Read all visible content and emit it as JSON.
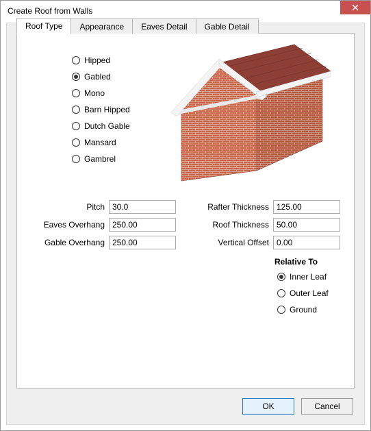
{
  "window": {
    "title": "Create Roof from Walls"
  },
  "tabs": [
    {
      "label": "Roof Type",
      "active": true
    },
    {
      "label": "Appearance",
      "active": false
    },
    {
      "label": "Eaves Detail",
      "active": false
    },
    {
      "label": "Gable Detail",
      "active": false
    }
  ],
  "roof_types": [
    {
      "label": "Hipped",
      "checked": false
    },
    {
      "label": "Gabled",
      "checked": true
    },
    {
      "label": "Mono",
      "checked": false
    },
    {
      "label": "Barn Hipped",
      "checked": false
    },
    {
      "label": "Dutch Gable",
      "checked": false
    },
    {
      "label": "Mansard",
      "checked": false
    },
    {
      "label": "Gambrel",
      "checked": false
    }
  ],
  "fields": {
    "left": [
      {
        "label": "Pitch",
        "value": "30.0"
      },
      {
        "label": "Eaves Overhang",
        "value": "250.00"
      },
      {
        "label": "Gable Overhang",
        "value": "250.00"
      }
    ],
    "right": [
      {
        "label": "Rafter Thickness",
        "value": "125.00"
      },
      {
        "label": "Roof Thickness",
        "value": "50.00"
      },
      {
        "label": "Vertical Offset",
        "value": "0.00"
      }
    ]
  },
  "relative_to": {
    "label": "Relative To",
    "options": [
      {
        "label": "Inner Leaf",
        "checked": true
      },
      {
        "label": "Outer Leaf",
        "checked": false
      },
      {
        "label": "Ground",
        "checked": false
      }
    ]
  },
  "buttons": {
    "ok": "OK",
    "cancel": "Cancel"
  },
  "colors": {
    "close_btn": "#c8504f",
    "brick": "#c8674b",
    "roof": "#8d3e35",
    "fascia": "#f4f4f4"
  }
}
